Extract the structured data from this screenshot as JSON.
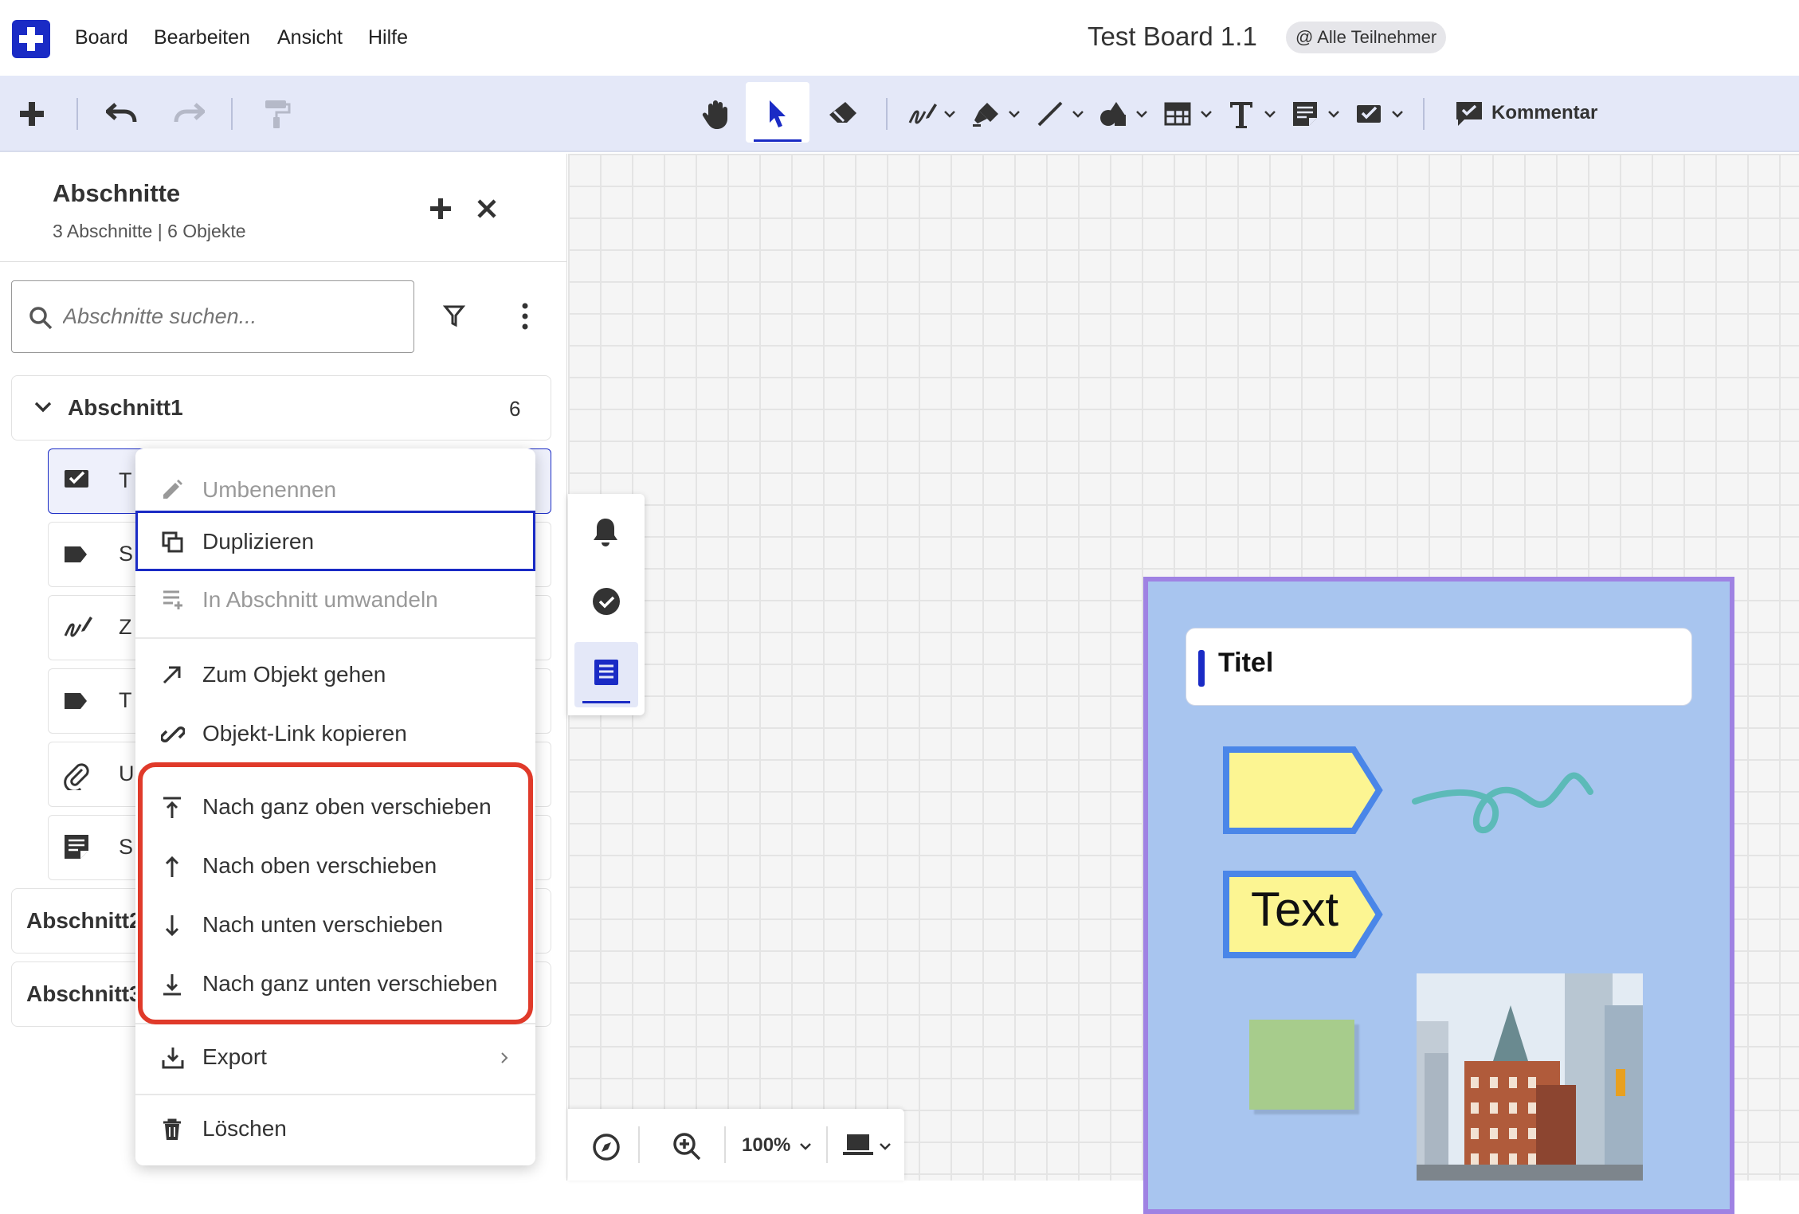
{
  "menubar": {
    "items": [
      "Board",
      "Bearbeiten",
      "Ansicht",
      "Hilfe"
    ],
    "board_title": "Test Board 1.1",
    "participants_badge": "@ Alle Teilnehmer"
  },
  "toolbar": {
    "comment_label": "Kommentar"
  },
  "sidebar": {
    "title": "Abschnitte",
    "subtitle": "3 Abschnitte | 6 Objekte",
    "search_placeholder": "Abschnitte suchen...",
    "sections": [
      {
        "name": "Abschnitt1",
        "count": "6",
        "objects": [
          {
            "label": "T",
            "icon": "checkbox-card-icon"
          },
          {
            "label": "S",
            "icon": "tag-icon"
          },
          {
            "label": "Z",
            "icon": "freehand-icon"
          },
          {
            "label": "T",
            "icon": "tag-icon"
          },
          {
            "label": "U",
            "icon": "attachment-icon"
          },
          {
            "label": "S",
            "icon": "note-icon"
          }
        ]
      },
      {
        "name": "Abschnitt2"
      },
      {
        "name": "Abschnitt3"
      }
    ]
  },
  "context_menu": {
    "items": [
      {
        "label": "Umbenennen",
        "icon": "pencil-icon",
        "disabled": true
      },
      {
        "label": "Duplizieren",
        "icon": "duplicate-icon",
        "focused": true
      },
      {
        "label": "In Abschnitt umwandeln",
        "icon": "convert-section-icon",
        "disabled": true
      },
      {
        "label": "Zum Objekt gehen",
        "icon": "arrow-diagonal-icon"
      },
      {
        "label": "Objekt-Link kopieren",
        "icon": "link-icon"
      },
      {
        "label": "Nach ganz oben verschieben",
        "icon": "move-top-icon"
      },
      {
        "label": "Nach oben verschieben",
        "icon": "move-up-icon"
      },
      {
        "label": "Nach unten verschieben",
        "icon": "move-down-icon"
      },
      {
        "label": "Nach ganz unten verschieben",
        "icon": "move-bottom-icon"
      },
      {
        "label": "Export",
        "icon": "export-icon",
        "submenu": true
      },
      {
        "label": "Löschen",
        "icon": "trash-icon"
      }
    ]
  },
  "canvas": {
    "title_card": "Titel",
    "text_tag": "Text"
  },
  "bottom_bar": {
    "zoom": "100%"
  },
  "colors": {
    "accent": "#1a2bc5",
    "toolbar_bg": "#e4e8f8",
    "section_frame": "#9f82e3",
    "section_fill": "#a8c5ef",
    "highlight": "#e03a2a",
    "tag_fill": "#fcf592",
    "tag_border": "#4a86e8"
  }
}
